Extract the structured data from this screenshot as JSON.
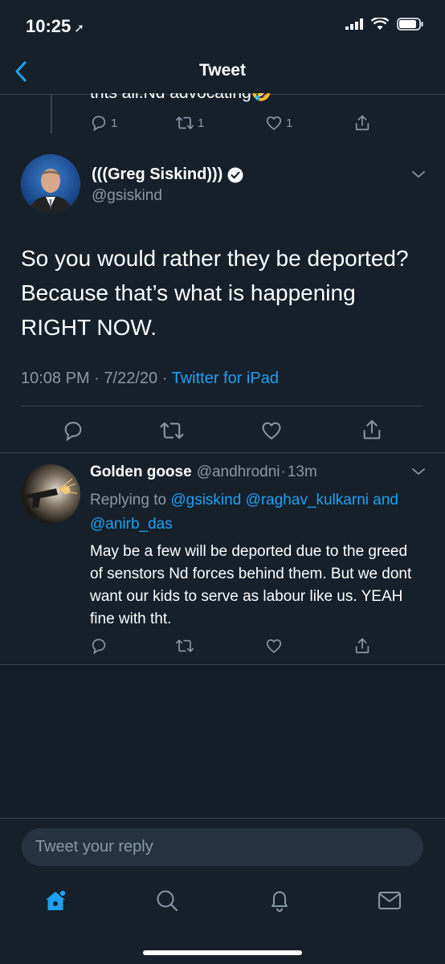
{
  "status_bar": {
    "time": "10:25",
    "location_icon": "location-arrow-icon"
  },
  "nav": {
    "title": "Tweet",
    "back_icon": "chevron-left-icon"
  },
  "parent_tweet": {
    "partial_text": "thts all.Nd advocating🤣",
    "reply_count": "1",
    "retweet_count": "1",
    "like_count": "1"
  },
  "main_tweet": {
    "name": "(((Greg Siskind)))",
    "handle": "@gsiskind",
    "verified": true,
    "text": "So you would rather they be deported? Because that’s what is happening RIGHT NOW.",
    "time": "10:08 PM",
    "date": "7/22/20",
    "separator": "·",
    "source": "Twitter for iPad"
  },
  "reply_tweet": {
    "name": "Golden goose",
    "handle": "@andhrodni",
    "age": "13m",
    "separator": "·",
    "replying_prefix": "Replying to",
    "replying_to_1": "@gsiskind",
    "replying_to_2": "@raghav_kulkarni",
    "replying_and": "and",
    "replying_to_3": "@anirb_das",
    "text": "May be a few will be deported due to the greed of senstors Nd forces behind them. But we dont want our kids to serve as labour like us. YEAH fine with tht."
  },
  "compose": {
    "placeholder": "Tweet your reply"
  },
  "colors": {
    "background": "#15202b",
    "accent": "#1da1f2",
    "muted": "#8899a6",
    "divider": "#38444d"
  },
  "tabs": [
    "home-icon",
    "search-icon",
    "notifications-icon",
    "messages-icon"
  ]
}
